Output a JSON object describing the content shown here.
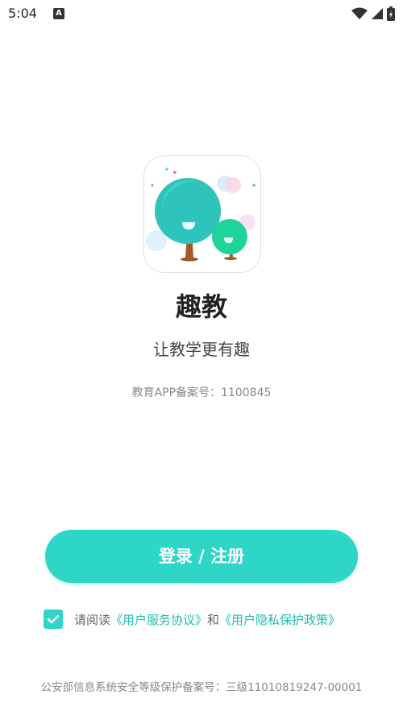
{
  "status_bar": {
    "time": "5:04"
  },
  "app": {
    "name": "趣教",
    "tagline": "让教学更有趣",
    "record": "教育APP备案号：1100845"
  },
  "login_button": {
    "label": "登录 / 注册"
  },
  "agreement": {
    "prefix": "请阅读",
    "user_service": "《用户服务协议》",
    "and": "和",
    "privacy": "《用户隐私保护政策》",
    "checked": true
  },
  "footer": {
    "text": "公安部信息系统安全等级保护备案号：三级11010819247-00001"
  },
  "colors": {
    "accent": "#2ed6c8",
    "link": "#1bbfb0"
  }
}
